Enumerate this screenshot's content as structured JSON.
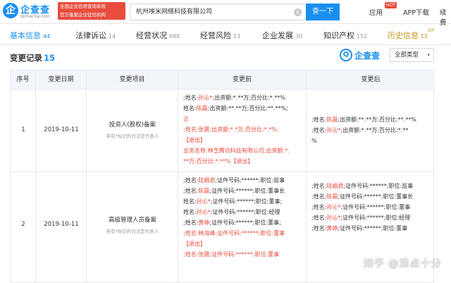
{
  "header": {
    "logo_char": "企",
    "logo_name": "企查查",
    "logo_domain": "qichacha.com",
    "slogan_line1": "全国企业信用查询系统",
    "slogan_line2": "官方备案企业征信机构",
    "search_value": "杭州埃米网络科技有限公司",
    "search_button": "查一下",
    "nav_apply": "应用",
    "nav_hot_badge": "HOT",
    "nav_app_download": "APP下载",
    "nav_continue": "续费"
  },
  "tabs": [
    {
      "label": "基本信息",
      "count": "44"
    },
    {
      "label": "法律诉讼",
      "count": "14"
    },
    {
      "label": "经营状况",
      "count": "688"
    },
    {
      "label": "经营风险",
      "count": "13"
    },
    {
      "label": "企业发展",
      "count": "30"
    },
    {
      "label": "知识产权",
      "count": "152"
    },
    {
      "label": "历史信息",
      "count": "15"
    }
  ],
  "vip_label": "VIP",
  "section": {
    "title": "变更记录",
    "count": "15",
    "watermark_logo": "企查查",
    "filter_label": "全部类型",
    "filter_arrow": "▾"
  },
  "table": {
    "headers": [
      "序号",
      "变更日期",
      "变更项目",
      "变更前",
      "变更后"
    ],
    "rows": [
      {
        "index": "1",
        "date": "2019-10-11",
        "item": "投资人(股权)备案",
        "item_note": "带有*标记的为法定代表人",
        "before": [
          ";姓名:孙沁*;出资额:*.**万;百分比:*.**%",
          "姓名:陈磊;出资额:**.**万;百分比:**.**%;",
          "企",
          ";姓名:张震;出资额:*.*万;百分比:*.*%;",
          "【退出】",
          "业务名称:林芝腾讯科技有限公司;出资额:*.",
          "**万;百分比:*.**%【退出】"
        ],
        "after": [
          ";姓名:陈磊;出资额:**.**万;百分比:**.**%",
          ";姓名:孙沁*;出资额:*.**万;百分比:*.**",
          "%"
        ]
      },
      {
        "index": "2",
        "date": "2019-10-11",
        "item": "高级管理人员备案",
        "item_note": "带有*标记的为法定代表人",
        "before": [
          ";姓名:陆娟君;证件号码:******;职位:监事",
          ";姓名:陈磊;证件号码:******;职位:董事长",
          "姓名:孙沁*;证件号码:******;职位:董事;",
          "姓名:孙沁*;证件号码:******;职位:经理",
          ";姓名:黄峥;证件号码:******;职位:董事;",
          ";姓名:林海峰;证件号码:******;职位:董事",
          "【退出】",
          ";姓名:张震;证件号码:******;职位:董事"
        ],
        "after": [
          ";姓名:陆娟君;证件号码:******;职位:监事",
          ";姓名:陈磊;证件号码:******;职位:董事长",
          ";姓名:孙沁*;证件号码:******;职位:董事",
          ";姓名:孙沁*;证件号码:******;职位:经理",
          ";姓名:黄峥;证件号码:******;职位:董事"
        ]
      }
    ]
  },
  "watermark_text": "知乎 @沸点十分"
}
